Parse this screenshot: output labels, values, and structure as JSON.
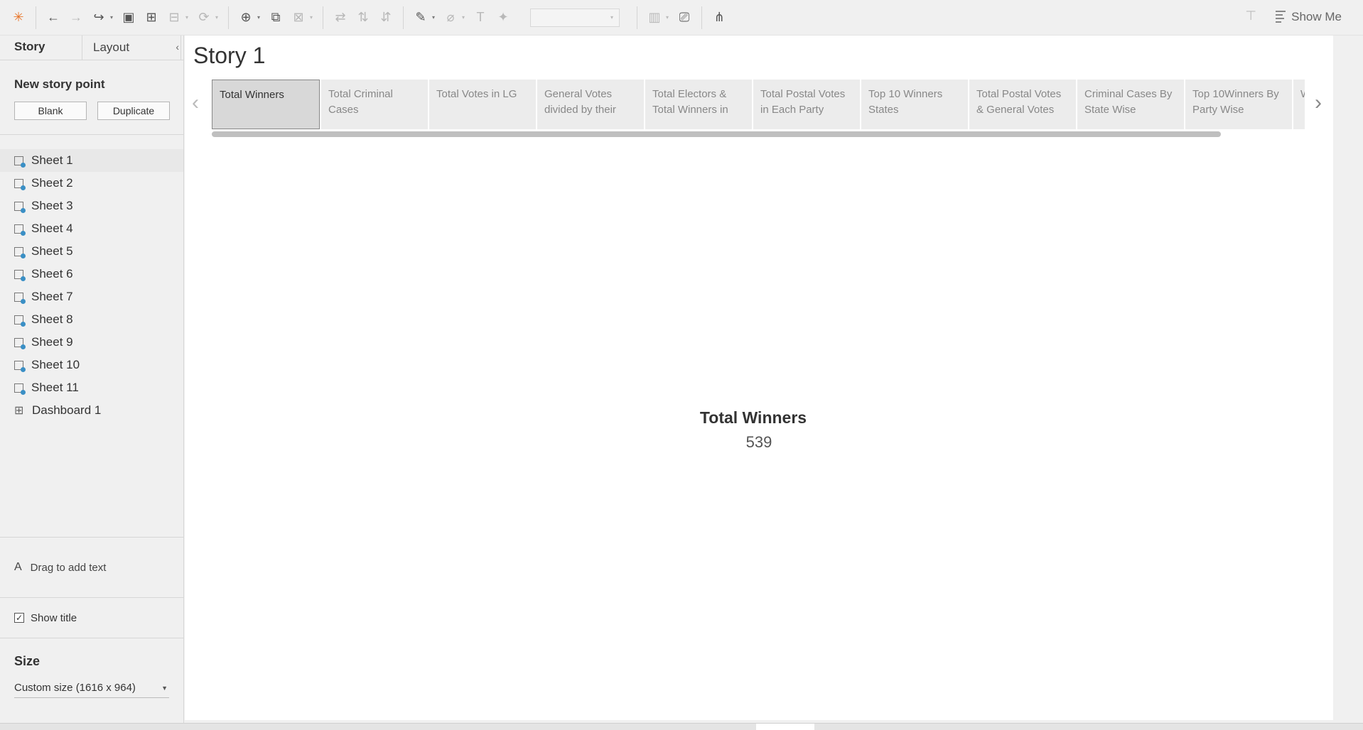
{
  "toolbar": {
    "icons": [
      "tableau-logo-icon",
      "undo-icon",
      "redo-icon",
      "replay-icon",
      "save-icon",
      "new-datasource-icon",
      "pause-update-icon",
      "refresh-icon",
      "new-worksheet-icon",
      "duplicate-icon",
      "clear-icon",
      "swap-icon",
      "sort-asc-icon",
      "sort-desc-icon",
      "highlight-icon",
      "group-icon",
      "label-icon",
      "fix-axes-icon",
      "fit-select",
      "show-cards-icon",
      "presentation-icon",
      "share-icon"
    ],
    "show_me_label": "Show Me"
  },
  "left_panel": {
    "tabs": [
      "Story",
      "Layout"
    ],
    "new_story_point_label": "New story point",
    "blank_label": "Blank",
    "duplicate_label": "Duplicate",
    "sheets": [
      "Sheet 1",
      "Sheet 2",
      "Sheet 3",
      "Sheet 4",
      "Sheet 5",
      "Sheet 6",
      "Sheet 7",
      "Sheet 8",
      "Sheet 9",
      "Sheet 10",
      "Sheet 11"
    ],
    "dashboard": "Dashboard 1",
    "drag_text": "Drag to add text",
    "show_title_label": "Show title",
    "show_title_checked": true,
    "size_label": "Size",
    "size_value": "Custom size (1616 x 964)"
  },
  "story": {
    "title": "Story 1",
    "points": [
      {
        "label": "Total Winners",
        "active": true
      },
      {
        "label": "Total Criminal Cases",
        "active": false
      },
      {
        "label": "Total Votes in LG",
        "active": false
      },
      {
        "label": "General Votes divided by their",
        "active": false
      },
      {
        "label": "Total Electors & Total Winners in",
        "active": false
      },
      {
        "label": "Total Postal Votes in Each Party",
        "active": false
      },
      {
        "label": "Top 10 Winners States",
        "active": false
      },
      {
        "label": "Total Postal Votes & General Votes",
        "active": false
      },
      {
        "label": "Criminal Cases By State Wise",
        "active": false
      },
      {
        "label": "Top 10Winners By Party Wise",
        "active": false
      },
      {
        "label": "W C",
        "active": false
      }
    ],
    "kpi_title": "Total Winners",
    "kpi_value": "539"
  },
  "colors": {
    "accent": "#3a8fc5",
    "active_point": "#d8d8d8"
  }
}
